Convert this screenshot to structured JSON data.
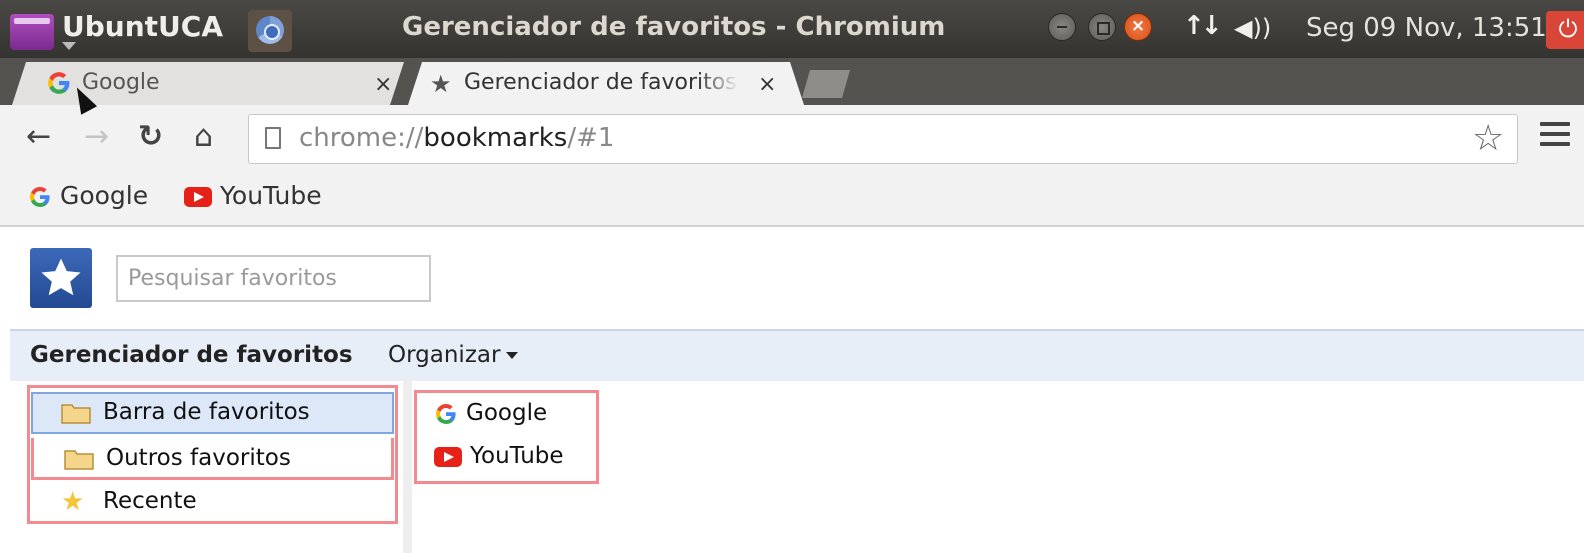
{
  "panel": {
    "brand": "UbuntUCA",
    "window_title": "Gerenciador de favoritos - Chromium",
    "clock": "Seg 09 Nov, 13:51",
    "icons": [
      "launcher-icon",
      "chromium-icon",
      "minimize-icon",
      "maximize-icon",
      "close-icon",
      "network-icon",
      "volume-icon",
      "power-icon"
    ]
  },
  "tabs": [
    {
      "title": "Google",
      "favicon": "google-icon",
      "close": "×"
    },
    {
      "title": "Gerenciador de favoritos",
      "favicon": "star-icon",
      "close": "×",
      "active": true
    }
  ],
  "toolbar": {
    "url_scheme": "chrome://",
    "url_host": "bookmarks",
    "url_path": "/#1"
  },
  "bookmarks_bar": [
    {
      "label": "Google",
      "icon": "google-icon"
    },
    {
      "label": "YouTube",
      "icon": "youtube-icon"
    }
  ],
  "manager": {
    "search_placeholder": "Pesquisar favoritos",
    "title": "Gerenciador de favoritos",
    "organize": "Organizar",
    "tree": [
      {
        "label": "Barra de favoritos",
        "icon": "folder-icon",
        "selected": true
      },
      {
        "label": "Outros favoritos",
        "icon": "folder-icon"
      },
      {
        "label": "Recente",
        "icon": "star-icon"
      }
    ],
    "list": [
      {
        "label": "Google",
        "icon": "google-icon"
      },
      {
        "label": "YouTube",
        "icon": "youtube-icon"
      }
    ]
  },
  "colors": {
    "highlight_border": "#f28a8f",
    "selection_bg": "#dce7f8",
    "header_bg": "#e8eef8",
    "logo_blue": "#2f5aa6"
  }
}
